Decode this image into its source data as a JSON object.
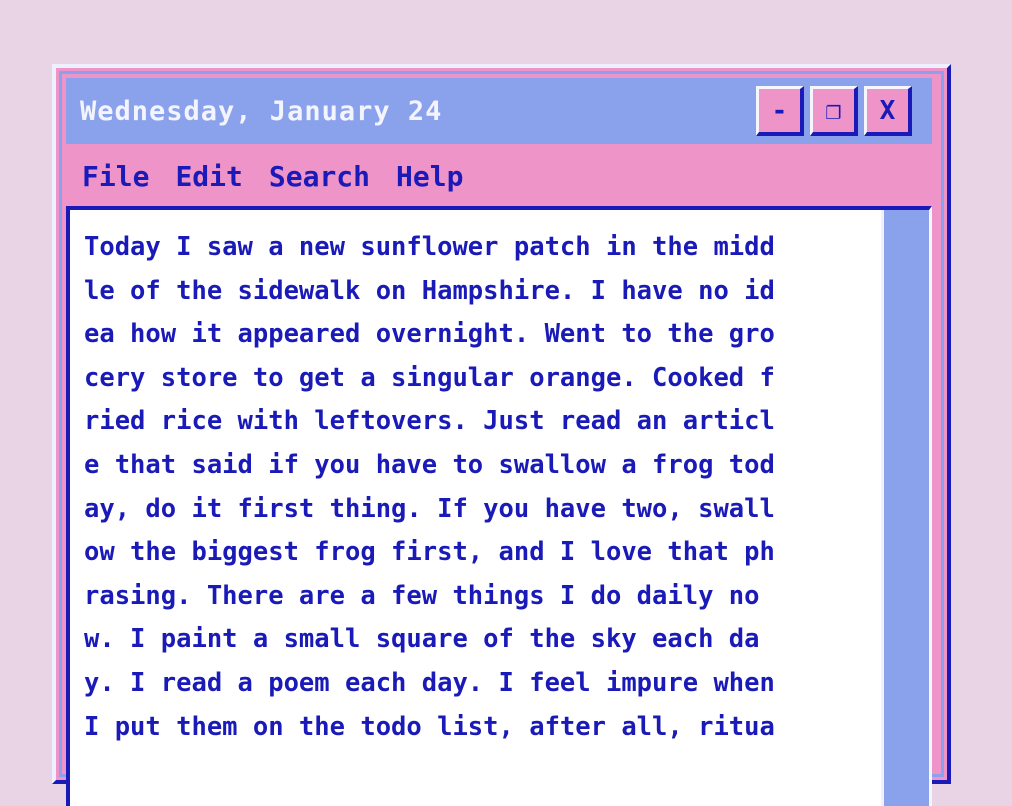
{
  "window": {
    "title": "Wednesday, January 24",
    "controls": {
      "minimize": "-",
      "maximize": "❐",
      "close": "X"
    }
  },
  "menu": [
    "File",
    "Edit",
    "Search",
    "Help"
  ],
  "document": {
    "lines": [
      "Today I saw a new sunflower patch in the midd",
      "le of the sidewalk on Hampshire. I have no id",
      "ea how it appeared overnight. Went to the gro",
      "cery store to get a singular orange. Cooked f",
      "ried rice with leftovers. Just read an articl",
      "e that said if you have to swallow a frog tod",
      "ay, do it first thing. If you have two, swall",
      "ow the biggest frog first, and I love that ph",
      "rasing. There are a few things I do daily no",
      "w. I paint a small square of the sky each da",
      "y. I read a poem each day. I feel impure when",
      "I put them on the todo list, after all, ritua"
    ]
  },
  "colors": {
    "background": "#e8d4e4",
    "window_pink": "#ee94c8",
    "titlebar_blue": "#8aa2ec",
    "text_navy": "#1a1ab8",
    "paper": "#ffffff"
  }
}
